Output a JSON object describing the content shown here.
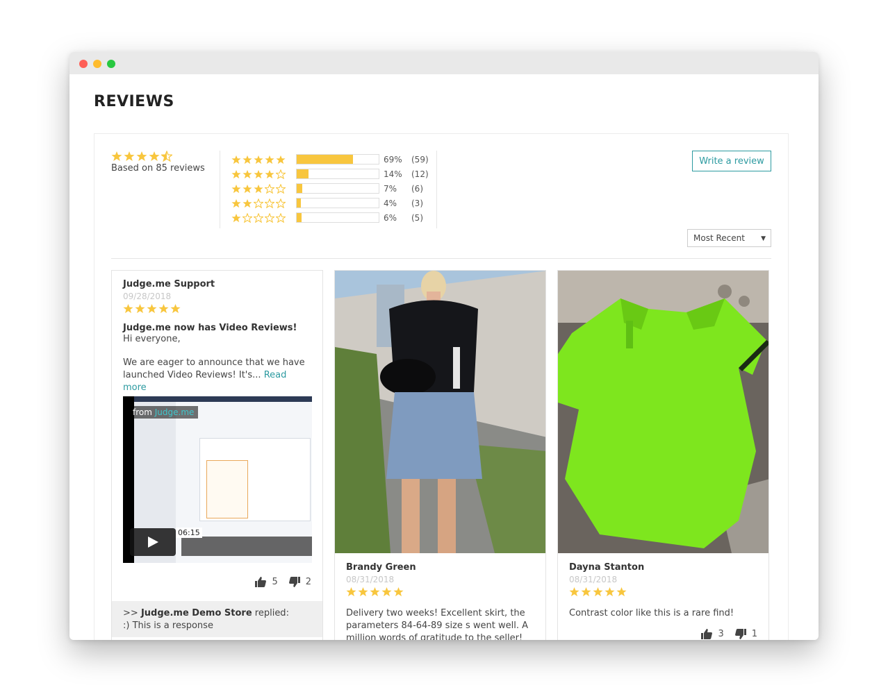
{
  "page": {
    "title": "REVIEWS"
  },
  "summary": {
    "average_stars": 4.5,
    "based_on": "Based on 85 reviews",
    "star_color": "#f8c63e"
  },
  "histogram": [
    {
      "stars": 5,
      "fraction": 0.69,
      "percent": "69%",
      "count": "(59)"
    },
    {
      "stars": 4,
      "fraction": 0.14,
      "percent": "14%",
      "count": "(12)"
    },
    {
      "stars": 3,
      "fraction": 0.07,
      "percent": "7%",
      "count": "(6)"
    },
    {
      "stars": 2,
      "fraction": 0.04,
      "percent": "4%",
      "count": "(3)"
    },
    {
      "stars": 1,
      "fraction": 0.06,
      "percent": "6%",
      "count": "(5)"
    }
  ],
  "actions": {
    "write_review": "Write a review"
  },
  "sort": {
    "selected": "Most Recent"
  },
  "accent_color": "#2c9aa0",
  "reviews": [
    {
      "author": "Judge.me Support",
      "date": "09/28/2018",
      "rating": 5,
      "title": "Judge.me now has Video Reviews!",
      "greeting": "Hi everyone,",
      "body": "We are eager to announce that we have launched Video Reviews! It's...",
      "read_more": "Read more",
      "video": {
        "from_label": "from",
        "brand": "Judge.me",
        "duration": "06:15"
      },
      "votes_up": "5",
      "votes_down": "2",
      "reply": {
        "prefix": ">>",
        "store": "Judge.me Demo Store",
        "verb": "replied:",
        "text": ":) This is a response"
      }
    },
    {
      "author": "Brandy Green",
      "date": "08/31/2018",
      "rating": 5,
      "photo": "black-tshirt-denim-skirt-photo",
      "body": "Delivery two weeks! Excellent skirt, the parameters 84-64-89 size s went well. A million words of gratitude to the seller!"
    },
    {
      "author": "Dayna Stanton",
      "date": "08/31/2018",
      "rating": 5,
      "photo": "lime-green-polo-photo",
      "body": "Contrast color like this is a rare find!",
      "votes_up": "3",
      "votes_down": "1"
    }
  ]
}
